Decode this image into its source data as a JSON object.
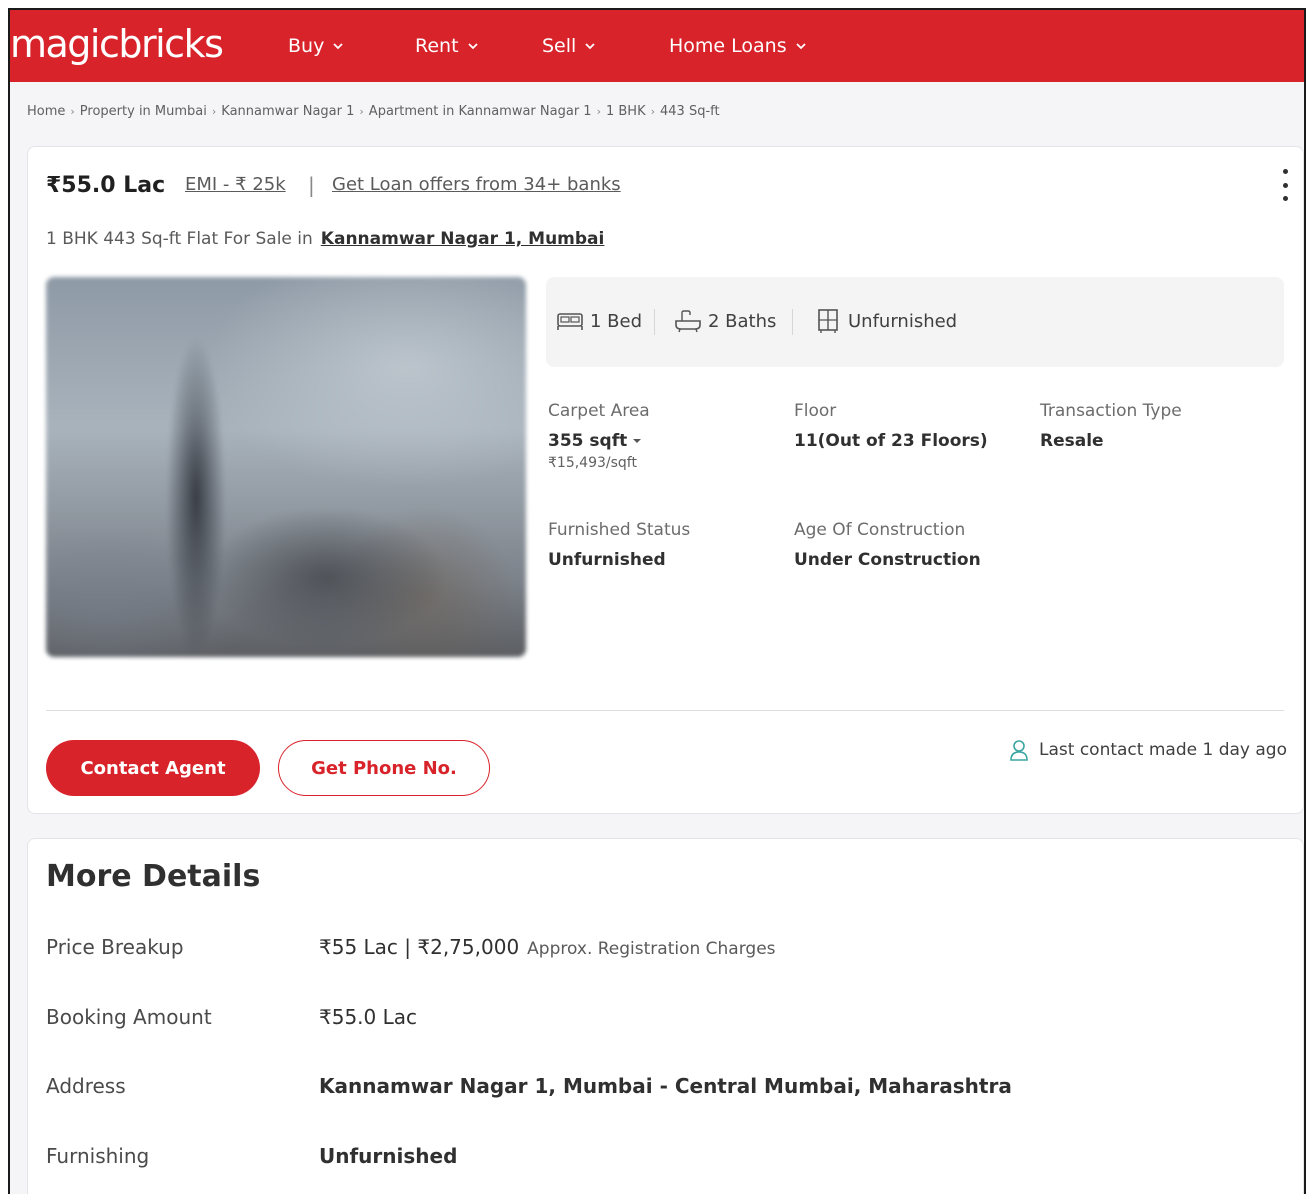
{
  "brand": {
    "name": "magicbricks",
    "accent": "#d8232a"
  },
  "nav": {
    "items": [
      {
        "label": "Buy"
      },
      {
        "label": "Rent"
      },
      {
        "label": "Sell"
      },
      {
        "label": "Home Loans"
      }
    ]
  },
  "breadcrumb": [
    "Home",
    "Property in Mumbai",
    "Kannamwar Nagar 1",
    "Apartment in Kannamwar Nagar 1",
    "1 BHK",
    "443 Sq-ft"
  ],
  "listing": {
    "price": "₹55.0 Lac",
    "emi": "EMI - ₹ 25k",
    "loan_offers": "Get Loan offers from 34+ banks",
    "title": "1 BHK 443 Sq-ft Flat For Sale in",
    "location": "Kannamwar Nagar 1, Mumbai",
    "amenities": {
      "bed": "1 Bed",
      "bath": "2 Baths",
      "furnishing": "Unfurnished"
    },
    "specs": {
      "carpet_area": {
        "label": "Carpet Area",
        "value": "355 sqft",
        "sub": "₹15,493/sqft"
      },
      "floor": {
        "label": "Floor",
        "value": "11(Out of 23 Floors)"
      },
      "transaction": {
        "label": "Transaction Type",
        "value": "Resale"
      },
      "furnished_status": {
        "label": "Furnished Status",
        "value": "Unfurnished"
      },
      "age": {
        "label": "Age Of Construction",
        "value": "Under Construction"
      }
    },
    "actions": {
      "contact_agent": "Contact Agent",
      "get_phone": "Get Phone No."
    },
    "last_contact": "Last contact made 1 day ago"
  },
  "more_details": {
    "heading": "More Details",
    "rows": [
      {
        "key": "Price Breakup",
        "value": "₹55 Lac | ₹2,75,000",
        "note": "Approx. Registration Charges"
      },
      {
        "key": "Booking Amount",
        "value": "₹55.0 Lac"
      },
      {
        "key": "Address",
        "value": "Kannamwar Nagar 1, Mumbai - Central Mumbai, Maharashtra"
      },
      {
        "key": "Furnishing",
        "value": "Unfurnished"
      }
    ]
  }
}
